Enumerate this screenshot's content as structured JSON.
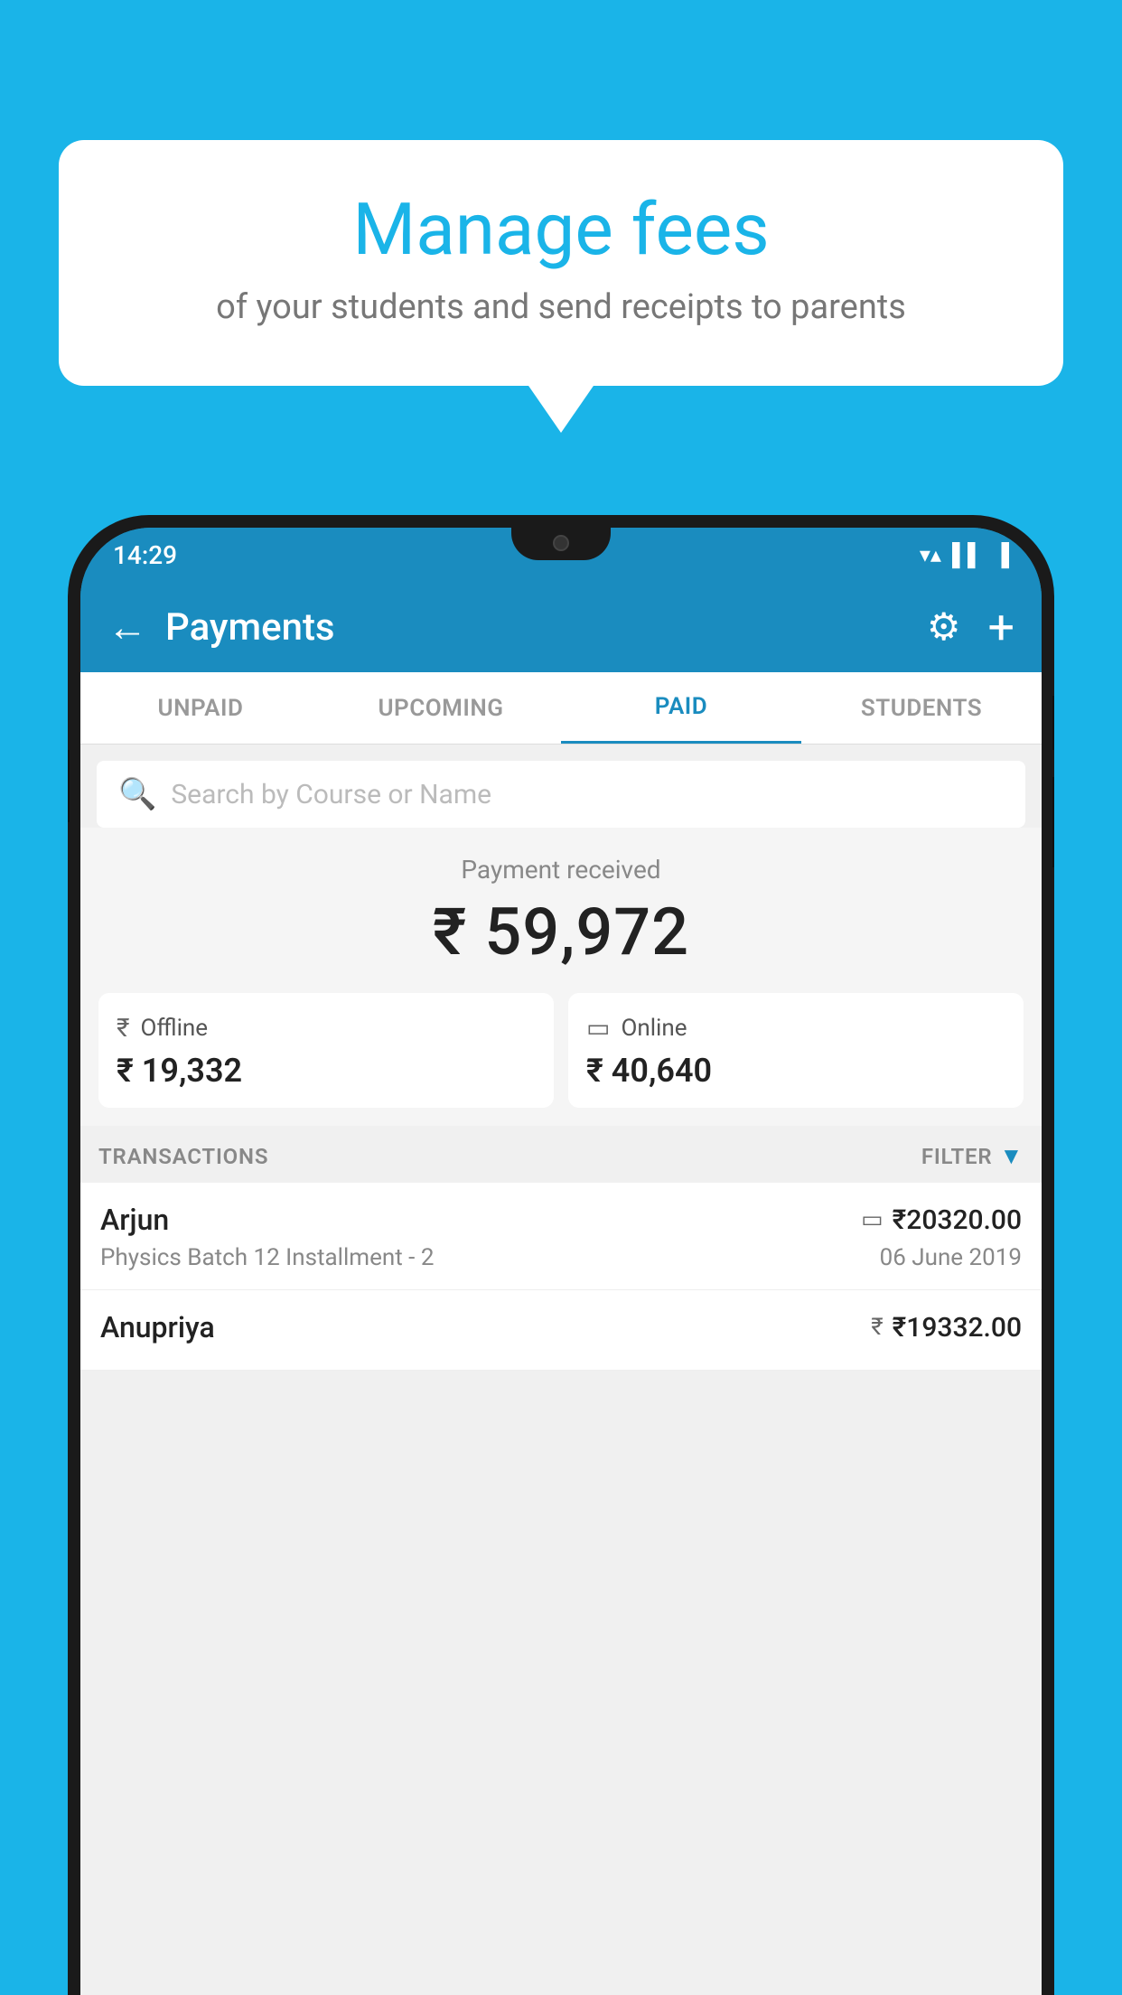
{
  "page": {
    "background_color": "#1ab4e8"
  },
  "speech_bubble": {
    "title": "Manage fees",
    "subtitle": "of your students and send receipts to parents"
  },
  "status_bar": {
    "time": "14:29",
    "wifi_unicode": "▼",
    "signal_unicode": "▲",
    "battery_unicode": "▐"
  },
  "header": {
    "back_label": "←",
    "title": "Payments",
    "gear_unicode": "⚙",
    "plus_label": "+"
  },
  "tabs": [
    {
      "label": "UNPAID",
      "active": false
    },
    {
      "label": "UPCOMING",
      "active": false
    },
    {
      "label": "PAID",
      "active": true
    },
    {
      "label": "STUDENTS",
      "active": false
    }
  ],
  "search": {
    "placeholder": "Search by Course or Name",
    "icon_unicode": "🔍"
  },
  "payment_summary": {
    "label": "Payment received",
    "amount": "₹ 59,972",
    "offline": {
      "type": "Offline",
      "amount": "₹ 19,332",
      "icon": "₹"
    },
    "online": {
      "type": "Online",
      "amount": "₹ 40,640",
      "icon": "▭"
    }
  },
  "transactions_section": {
    "label": "TRANSACTIONS",
    "filter_label": "FILTER",
    "filter_icon": "▼"
  },
  "transactions": [
    {
      "name": "Arjun",
      "course": "Physics Batch 12 Installment - 2",
      "amount": "₹20320.00",
      "date": "06 June 2019",
      "type_icon": "▭"
    },
    {
      "name": "Anupriya",
      "course": "",
      "amount": "₹19332.00",
      "date": "",
      "type_icon": "₹"
    }
  ]
}
